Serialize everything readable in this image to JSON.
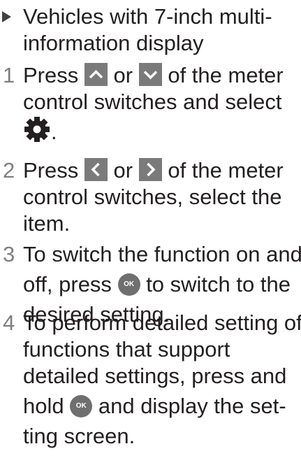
{
  "heading": {
    "line1": "Vehicles with 7-inch multi-",
    "line2": "information display"
  },
  "steps": [
    {
      "number": "1",
      "text_a": "Press",
      "text_b": "or",
      "text_c": "of the meter",
      "text_d": "control switches and select",
      "text_e": "."
    },
    {
      "number": "2",
      "text_a": "Press",
      "text_b": "or",
      "text_c": "of the meter",
      "text_d": "control switches, select the",
      "text_e": "item."
    },
    {
      "number": "3",
      "text_a": "To switch the function on and",
      "text_b": "off, press",
      "text_c": "to switch to the",
      "text_d": "desired setting."
    },
    {
      "number": "4",
      "text_a": "To perform detailed setting of",
      "text_b": "functions that support",
      "text_c": "detailed settings, press and",
      "text_d": "hold",
      "text_e": "and display the set-",
      "text_f": "ting screen."
    }
  ],
  "button_labels": {
    "ok": "OK"
  },
  "icons": {
    "up": "chevron-up-icon",
    "down": "chevron-down-icon",
    "left": "chevron-left-icon",
    "right": "chevron-right-icon",
    "settings": "gear-icon",
    "ok": "ok-button-icon"
  },
  "colors": {
    "text": "#231f20",
    "step_number": "#7f7f7f",
    "button_fill": "#7a7a7a"
  }
}
